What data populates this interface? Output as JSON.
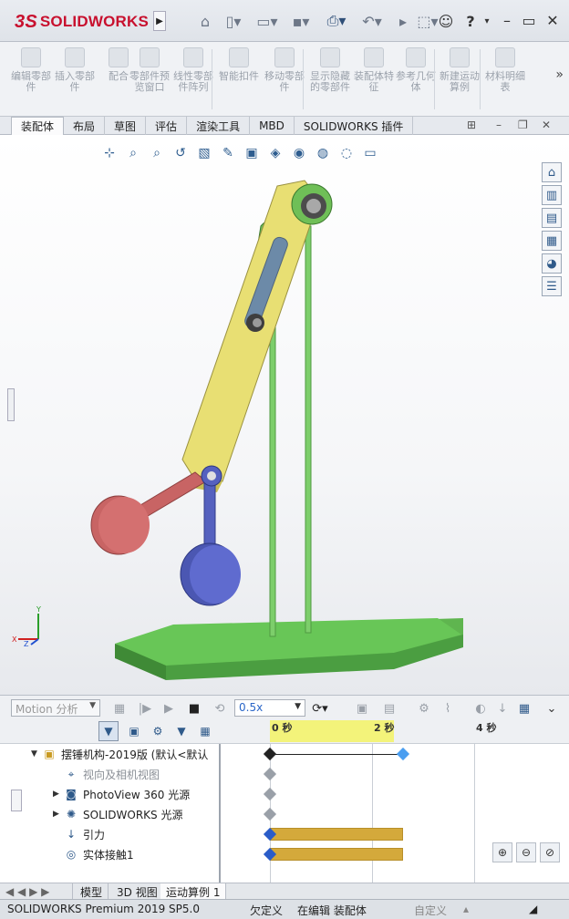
{
  "app": {
    "logo_text": "SOLIDWORKS",
    "logo_mark": "3S"
  },
  "title_toolbar": {
    "icons": [
      "home-icon",
      "new-file-icon",
      "open-file-icon",
      "print-icon",
      "undo-icon",
      "select-icon",
      "user-icon",
      "help-icon",
      "minimize-icon",
      "maximize-icon",
      "close-icon"
    ],
    "help_label": "?"
  },
  "ribbon": {
    "buttons": [
      {
        "label": "编辑零部件",
        "icon": "edit-component-icon"
      },
      {
        "label": "插入零部件",
        "icon": "insert-component-icon"
      },
      {
        "label": "配合",
        "icon": "mate-icon"
      },
      {
        "label": "零部件预览窗口",
        "icon": "preview-window-icon"
      },
      {
        "label": "线性零部件阵列",
        "icon": "linear-pattern-icon"
      },
      {
        "label": "智能扣件",
        "icon": "smart-fastener-icon"
      },
      {
        "label": "移动零部件",
        "icon": "move-component-icon"
      },
      {
        "label": "显示隐藏的零部件",
        "icon": "show-hidden-icon"
      },
      {
        "label": "装配体特征",
        "icon": "assembly-feature-icon"
      },
      {
        "label": "参考几何体",
        "icon": "reference-geometry-icon"
      },
      {
        "label": "新建运动算例",
        "icon": "new-motion-study-icon"
      },
      {
        "label": "材料明细表",
        "icon": "bom-icon"
      }
    ],
    "more": "»"
  },
  "tabs": [
    "装配体",
    "布局",
    "草图",
    "评估",
    "渲染工具",
    "MBD",
    "SOLIDWORKS 插件"
  ],
  "active_tab": 0,
  "graphics": {
    "heads_up_icons": [
      "view-orientation-icon",
      "zoom-to-fit-icon",
      "zoom-area-icon",
      "previous-view-icon",
      "section-view-icon",
      "dynamic-annotation-icon",
      "view-orientation-cube-icon",
      "display-style-icon",
      "hide-show-icon",
      "edit-appearance-icon",
      "apply-scene-icon",
      "view-settings-icon"
    ],
    "task_pane_icons": [
      "solidworks-resources-icon",
      "design-library-icon",
      "file-explorer-icon",
      "view-palette-icon",
      "appearances-icon",
      "custom-properties-icon"
    ],
    "triad": {
      "x": "X",
      "y": "Y",
      "z": "Z"
    },
    "colors": {
      "link_yellow": "#e8df73",
      "link_green": "#6fbf57",
      "pendulum_red": "#c86464",
      "pendulum_blue": "#5561bf",
      "base_green": "#68c657",
      "pole_green": "#7dce6b",
      "link_steel": "#6c8aa8"
    }
  },
  "motion": {
    "study_type": "Motion 分析",
    "speed": "0.5x",
    "toolbar_icons": [
      "calculate-icon",
      "play-from-start-icon",
      "play-icon",
      "stop-icon",
      "playback-mode-icon",
      "save-animation-icon",
      "animation-wizard-icon",
      "autokey-icon",
      "add-key-icon",
      "motor-icon",
      "spring-icon",
      "damper-icon",
      "force-icon",
      "contact-icon",
      "gravity-icon",
      "results-icon",
      "study-properties-icon",
      "collapse-icon"
    ],
    "filter_icons": [
      "filter-animated-icon",
      "filter-driving-icon",
      "filter-selected-icon",
      "filter-results-icon",
      "filter-custom-icon"
    ],
    "tree": [
      {
        "label": "摆锤机构-2019版  (默认<默认",
        "icon": "assembly-icon",
        "expander": "▼",
        "level": 0,
        "dim": false
      },
      {
        "label": "视向及相机视图",
        "icon": "camera-icon",
        "expander": "",
        "level": 1,
        "dim": true
      },
      {
        "label": "PhotoView 360 光源",
        "icon": "photoview-light-icon",
        "expander": "▶",
        "level": 1,
        "dim": false
      },
      {
        "label": "SOLIDWORKS 光源",
        "icon": "solidworks-light-icon",
        "expander": "▶",
        "level": 1,
        "dim": false
      },
      {
        "label": "引力",
        "icon": "gravity-icon",
        "expander": "",
        "level": 1,
        "dim": false
      },
      {
        "label": "实体接触1",
        "icon": "contact-icon",
        "expander": "",
        "level": 1,
        "dim": false
      }
    ],
    "timeline": {
      "ticks": [
        "0 秒",
        "2 秒",
        "4 秒"
      ],
      "keys": [
        {
          "row": 0,
          "time_sec": 0,
          "color": "#222222"
        },
        {
          "row": 0,
          "time_sec": 2.6,
          "color": "#4a9ef0"
        },
        {
          "row": 1,
          "time_sec": 0,
          "color": "#9aa0a8"
        },
        {
          "row": 2,
          "time_sec": 0,
          "color": "#9aa0a8"
        },
        {
          "row": 3,
          "time_sec": 0,
          "color": "#9aa0a8"
        },
        {
          "row": 4,
          "time_sec": 0,
          "color": "#2a5cc8"
        },
        {
          "row": 5,
          "time_sec": 0,
          "color": "#2a5cc8"
        }
      ],
      "bars": [
        {
          "row": 4,
          "start_sec": 0,
          "end_sec": 2.6,
          "color": "#d4a93b"
        },
        {
          "row": 5,
          "start_sec": 0,
          "end_sec": 2.6,
          "color": "#d4a93b"
        }
      ],
      "span_line": {
        "row": 0,
        "start_sec": 0,
        "end_sec": 2.6
      }
    },
    "zoom_icons": [
      "zoom-in-timeline-icon",
      "zoom-out-timeline-icon",
      "zoom-fit-timeline-icon"
    ]
  },
  "bottom_tabs": {
    "items": [
      "模型",
      "3D 视图",
      "运动算例 1"
    ],
    "active": 2
  },
  "status": {
    "product": "SOLIDWORKS Premium 2019 SP5.0",
    "definition": "欠定义",
    "mode": "在编辑 装配体",
    "units": "自定义"
  }
}
